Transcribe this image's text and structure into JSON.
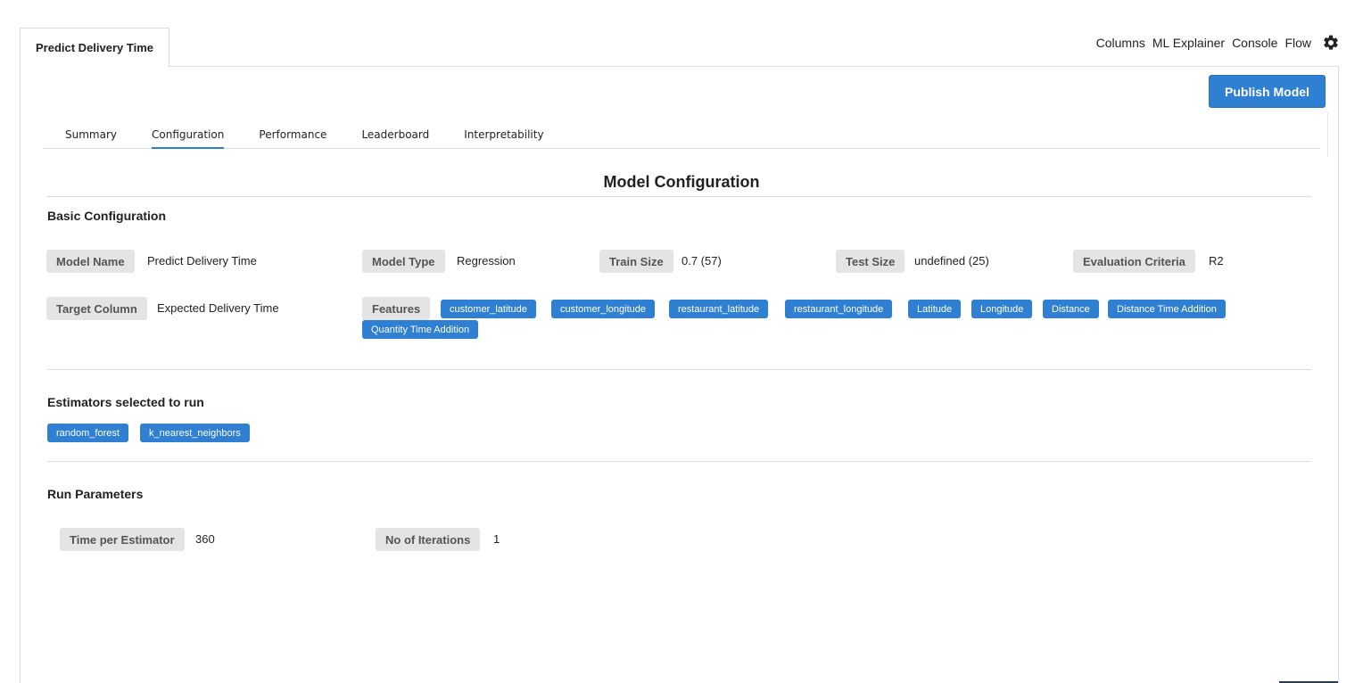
{
  "doc_tab": {
    "label": "Predict Delivery Time"
  },
  "top_nav": {
    "links": [
      "Columns",
      "ML Explainer",
      "Console",
      "Flow"
    ],
    "settings_icon": "gear-icon"
  },
  "publish_button": {
    "label": "Publish Model"
  },
  "subtabs": [
    {
      "label": "Summary",
      "active": false
    },
    {
      "label": "Configuration",
      "active": true
    },
    {
      "label": "Performance",
      "active": false
    },
    {
      "label": "Leaderboard",
      "active": false
    },
    {
      "label": "Interpretability",
      "active": false
    }
  ],
  "title": "Model Configuration",
  "basic": {
    "heading": "Basic Configuration",
    "model_name": {
      "label": "Model Name",
      "value": "Predict Delivery Time"
    },
    "model_type": {
      "label": "Model Type",
      "value": "Regression"
    },
    "train_size": {
      "label": "Train Size",
      "value": "0.7 (57)"
    },
    "test_size": {
      "label": "Test Size",
      "value": "undefined (25)"
    },
    "evaluation": {
      "label": "Evaluation Criteria",
      "value": "R2"
    },
    "target_column": {
      "label": "Target Column",
      "value": "Expected Delivery Time"
    },
    "features": {
      "label": "Features",
      "items": [
        "customer_latitude",
        "customer_longitude",
        "restaurant_latitude",
        "restaurant_longitude",
        "Latitude",
        "Longitude",
        "Distance",
        "Distance Time Addition",
        "Quantity Time Addition"
      ]
    }
  },
  "estimators": {
    "heading": "Estimators selected to run",
    "items": [
      "random_forest",
      "k_nearest_neighbors"
    ]
  },
  "run_params": {
    "heading": "Run Parameters",
    "time_per_estimator": {
      "label": "Time per Estimator",
      "value": "360"
    },
    "iterations": {
      "label": "No of Iterations",
      "value": "1"
    }
  },
  "colors": {
    "accent": "#2f7fd2",
    "chip_bg": "#e4e4e4",
    "border": "#dcdcdc"
  }
}
